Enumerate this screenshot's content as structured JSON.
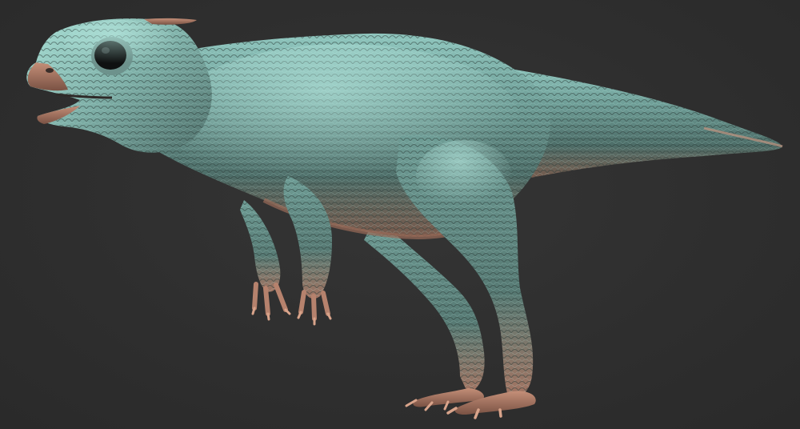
{
  "scene": {
    "subject_icon": "dinosaur-render-icon",
    "colors": {
      "background": "#2f2f2f",
      "skin_highlight": "#9fd8cf",
      "skin_mid": "#5f8c86",
      "skin_shadow": "#3a4f4d",
      "copper_rim": "#b07a62",
      "copper_dark": "#6e4a3e",
      "eye": "#0f1111"
    }
  }
}
